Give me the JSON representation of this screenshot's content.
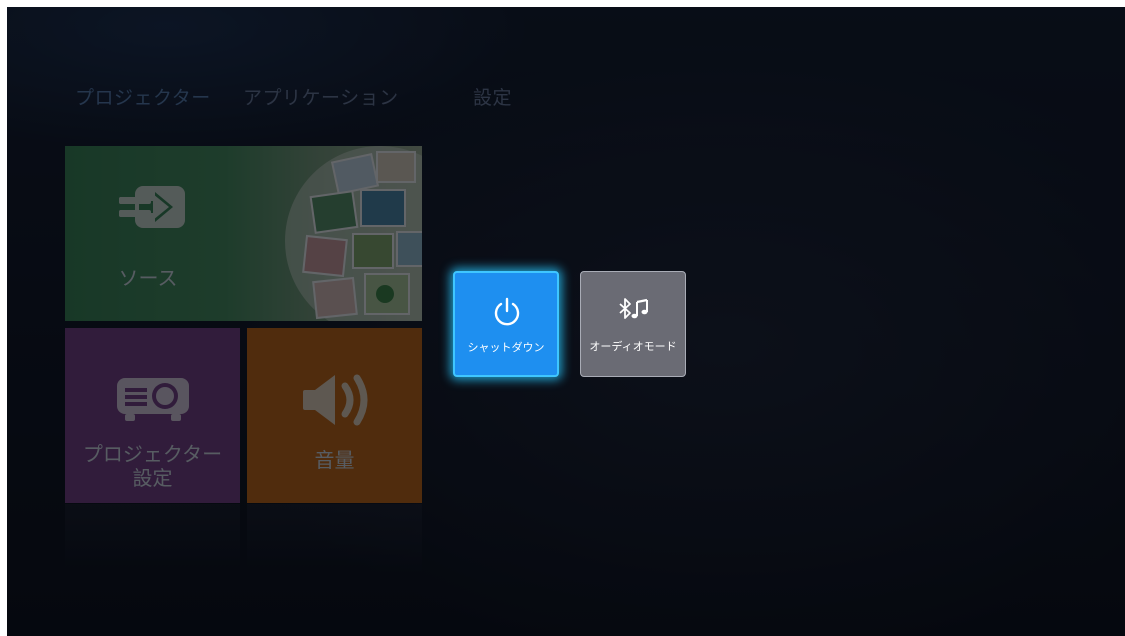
{
  "tabs": [
    {
      "label": "プロジェクター",
      "active": true
    },
    {
      "label": "アプリケーション",
      "active": false
    },
    {
      "label": "設定",
      "active": false
    }
  ],
  "tiles": {
    "source": {
      "label": "ソース",
      "icon": "input-arrow-icon",
      "color": "#3a7a4c"
    },
    "projector_settings": {
      "label_line1": "プロジェクター",
      "label_line2": "設定",
      "icon": "projector-icon",
      "color": "#7a3f86"
    },
    "volume": {
      "label": "音量",
      "icon": "speaker-icon",
      "color": "#c96a12"
    }
  },
  "power_menu": {
    "shutdown": {
      "label": "シャットダウン",
      "icon": "power-icon",
      "color": "#1e8ff0",
      "focused": true
    },
    "audio_mode": {
      "label": "オーディオモード",
      "icon": "bluetooth-music-icon",
      "color": "#6a6b74",
      "focused": false
    }
  }
}
